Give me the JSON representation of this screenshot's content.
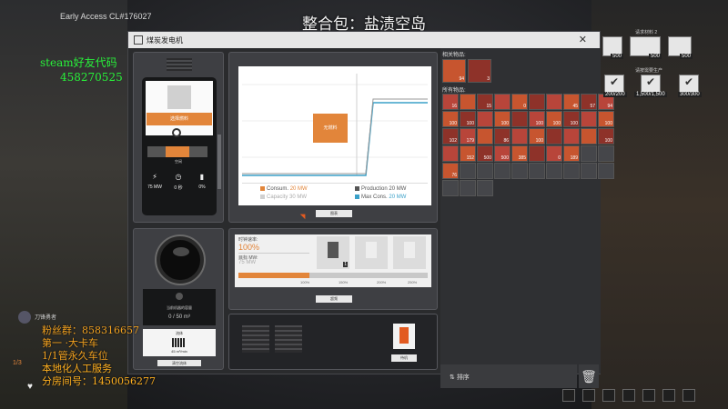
{
  "hud": {
    "build": "Early Access CL#176027",
    "modpack_title": "整合包：盐渍空岛",
    "steam_label": "steam好友代码",
    "steam_code": "458270525",
    "overlay_lines": [
      "粉丝群：858316657",
      "第一 ·大卡车",
      "1/1管永久车位",
      "本地化人工服务",
      "分房间号：1450056277"
    ],
    "player_name": "刀锋勇者",
    "hp_ratio": "1/3"
  },
  "window": {
    "title": "煤炭发电机",
    "close": "✕"
  },
  "generator": {
    "select_button": "选择燃料",
    "status": "空闲",
    "stats": [
      {
        "icon": "power-icon",
        "label": "75 MW"
      },
      {
        "icon": "clock-icon",
        "label": "0 秒"
      },
      {
        "icon": "battery-icon",
        "label": "0%"
      }
    ]
  },
  "chart": {
    "center_label": "无燃料",
    "legend": [
      {
        "label": "Consum.",
        "value": "20 MW",
        "color": "#e2853a"
      },
      {
        "label": "Production",
        "value": "20 MW",
        "color": "#555555"
      },
      {
        "label": "Capacity",
        "value": "30 MW",
        "color": "#d0d0d0"
      },
      {
        "label": "Max Cons.",
        "value": "20 MW",
        "color": "#3aa0c8"
      }
    ],
    "button": "图表"
  },
  "overclock": {
    "label": "时钟速率:",
    "value": "100%",
    "target_label": "目标 MW:",
    "target_value": "75 MW",
    "slot_badge": "1",
    "ticks": [
      "100%",
      "150%",
      "200%",
      "250%"
    ],
    "button": "超频"
  },
  "shard": {
    "caption": "当前机器的容量",
    "capacity": "0 / 50 m³",
    "panel_caption": "流体",
    "panel_value": "45 m³/min",
    "button": "清空流体"
  },
  "power_switch": {
    "button": "待机"
  },
  "inventory": {
    "related_label": "相关物品:",
    "related_items": [
      {
        "count": "94"
      },
      {
        "count": "3"
      }
    ],
    "all_label": "所有物品:",
    "rows": [
      [
        "16",
        "",
        "15",
        "",
        "0",
        "",
        "",
        "45",
        "57",
        "94"
      ],
      [
        "100",
        "100",
        "",
        "100",
        "",
        "100",
        "100",
        "100",
        "",
        "100"
      ],
      [
        "102",
        "179",
        "",
        "86",
        "",
        "100",
        "",
        "",
        "",
        "100"
      ],
      [
        "",
        "152",
        "500",
        "500",
        "385",
        "",
        "0",
        "189",
        "",
        ""
      ],
      [
        "76",
        "",
        "",
        "",
        "",
        "",
        "",
        "",
        "",
        ""
      ]
    ],
    "sort_label": "排序"
  },
  "quickbar": {
    "top_label": "请求材料 2",
    "items": [
      {
        "badge": "500"
      },
      {
        "badge": "500"
      },
      {
        "badge": "500"
      }
    ],
    "mid_label": "请按需要生产",
    "checks": [
      {
        "badge": "200/200"
      },
      {
        "badge": "1,500/1,500"
      },
      {
        "badge": "300/300"
      }
    ]
  }
}
